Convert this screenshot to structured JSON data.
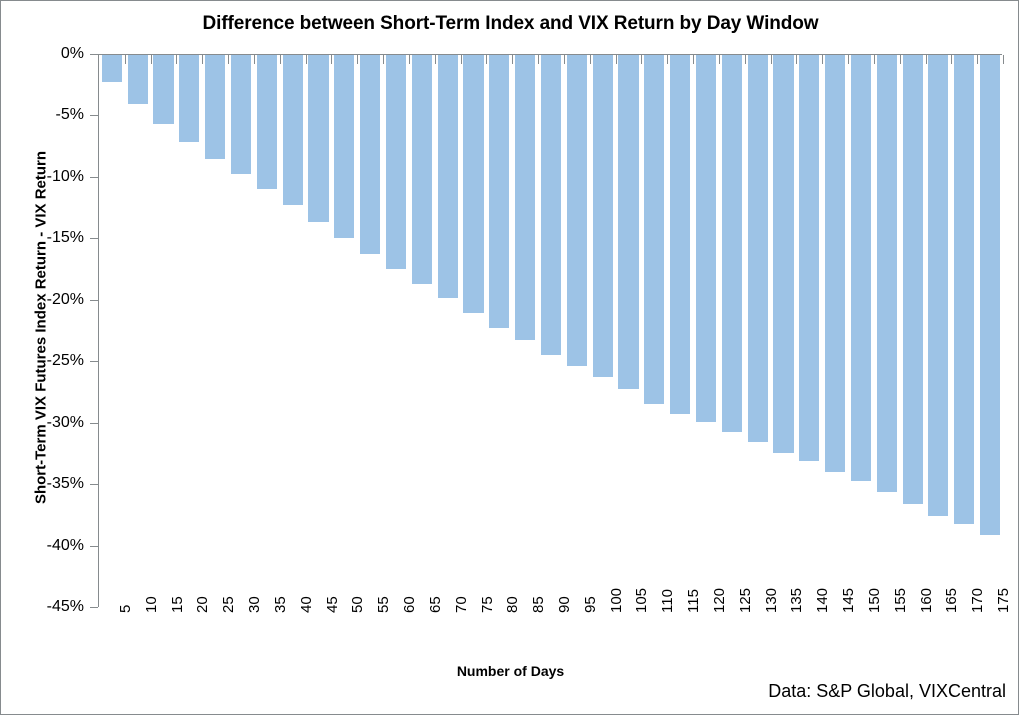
{
  "chart_data": {
    "type": "bar",
    "title": "Difference between Short-Term Index and VIX Return by Day Window",
    "xlabel": "Number of Days",
    "ylabel": "Short-Term VIX Futures Index Return - VIX Return",
    "categories": [
      "5",
      "10",
      "15",
      "20",
      "25",
      "30",
      "35",
      "40",
      "45",
      "50",
      "55",
      "60",
      "65",
      "70",
      "75",
      "80",
      "85",
      "90",
      "95",
      "100",
      "105",
      "110",
      "115",
      "120",
      "125",
      "130",
      "135",
      "140",
      "145",
      "150",
      "155",
      "160",
      "165",
      "170",
      "175"
    ],
    "values": [
      -2.2,
      -4.0,
      -5.6,
      -7.1,
      -8.5,
      -9.7,
      -10.9,
      -12.2,
      -13.6,
      -14.9,
      -16.2,
      -17.4,
      -18.6,
      -19.8,
      -21.0,
      -22.2,
      -23.2,
      -24.4,
      -25.3,
      -26.2,
      -27.2,
      -28.4,
      -29.2,
      -29.9,
      -30.7,
      -31.5,
      -32.4,
      -33.0,
      -33.9,
      -34.7,
      -35.6,
      -36.5,
      -37.5,
      -38.2,
      -39.1
    ],
    "ylim": [
      -45,
      0
    ],
    "ytick_labels": [
      "0%",
      "-5%",
      "-10%",
      "-15%",
      "-20%",
      "-25%",
      "-30%",
      "-35%",
      "-40%",
      "-45%"
    ],
    "ytick_values": [
      0,
      -5,
      -10,
      -15,
      -20,
      -25,
      -30,
      -35,
      -40,
      -45
    ],
    "grid": false,
    "legend": "none",
    "series_color": "#9dc3e6",
    "axis_color": "#868b8e",
    "source_note": "Data: S&P Global, VIXCentral",
    "xtick_rotation": -90,
    "value_unit": "percent"
  }
}
